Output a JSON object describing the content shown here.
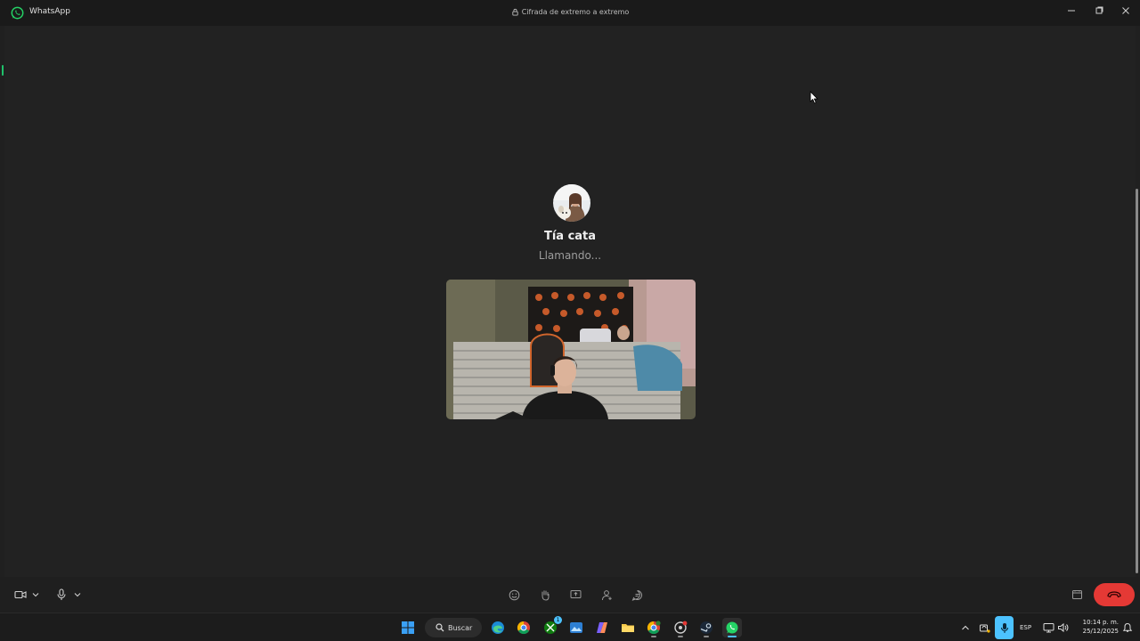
{
  "window": {
    "app_name": "WhatsApp",
    "encryption_label": "Cifrada de extremo a extremo"
  },
  "call": {
    "contact_name": "Tía cata",
    "status": "Llamando..."
  },
  "taskbar": {
    "search_label": "Buscar",
    "language": "ESP",
    "time": "10:14 p. m.",
    "date": "25/12/2025",
    "badge_xbox": "1"
  },
  "colors": {
    "accent_green": "#1fc26b",
    "end_call_red": "#e53935",
    "mic_active_blue": "#4cc2ff"
  },
  "icons": [
    "whatsapp-logo-icon",
    "lock-icon",
    "minimize-icon",
    "maximize-icon",
    "close-icon",
    "camera-icon",
    "microphone-icon",
    "emoji-icon",
    "raise-hand-icon",
    "screen-share-icon",
    "add-person-icon",
    "chat-icon",
    "layout-icon",
    "end-call-icon"
  ]
}
